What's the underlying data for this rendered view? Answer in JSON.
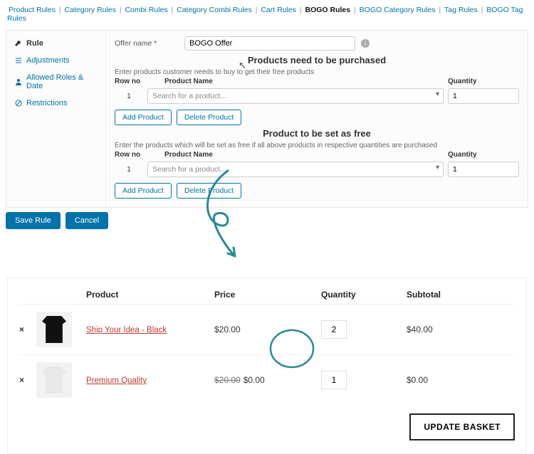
{
  "tabs": [
    "Product Rules",
    "Category Rules",
    "Combi Rules",
    "Category Combi Rules",
    "Cart Rules",
    "BOGO Rules",
    "BOGO Category Rules",
    "Tag Rules",
    "BOGO Tag Rules"
  ],
  "tabs_active": 5,
  "sidebar": {
    "items": [
      {
        "label": "Rule"
      },
      {
        "label": "Adjustments"
      },
      {
        "label": "Allowed Roles & Date"
      },
      {
        "label": "Restrictions"
      }
    ]
  },
  "form": {
    "offer_label": "Offer name *",
    "offer_value": "BOGO Offer",
    "section_purchase": "Products need to be purchased",
    "section_free": "Product to be set as free",
    "hint_purchase": "Enter products customer needs to buy to get their free products",
    "hint_free": "Enter the products which will be set as free if all above products in respective quantities are purchased",
    "col_rowno": "Row no",
    "col_product": "Product Name",
    "col_qty": "Quantity",
    "rowno": "1",
    "search_placeholder": "Search for a product...",
    "qty_value": "1",
    "add_product": "Add Product",
    "delete_product": "Delete Product"
  },
  "save": {
    "save": "Save Rule",
    "cancel": "Cancel"
  },
  "cart": {
    "headers": {
      "product": "Product",
      "price": "Price",
      "qty": "Quantity",
      "subtotal": "Subtotal"
    },
    "rows": [
      {
        "remove": "×",
        "name": "Ship Your Idea - Black",
        "price": "$20.00",
        "strike": "",
        "qty": "2",
        "subtotal": "$40.00"
      },
      {
        "remove": "×",
        "name": "Premium Quality",
        "price": "$0.00",
        "strike": "$20.00",
        "qty": "1",
        "subtotal": "$0.00"
      }
    ],
    "update": "UPDATE BASKET"
  },
  "colors": {
    "accent": "#0073aa",
    "link_red": "#c0392b",
    "teal": "#2a8a8f"
  }
}
